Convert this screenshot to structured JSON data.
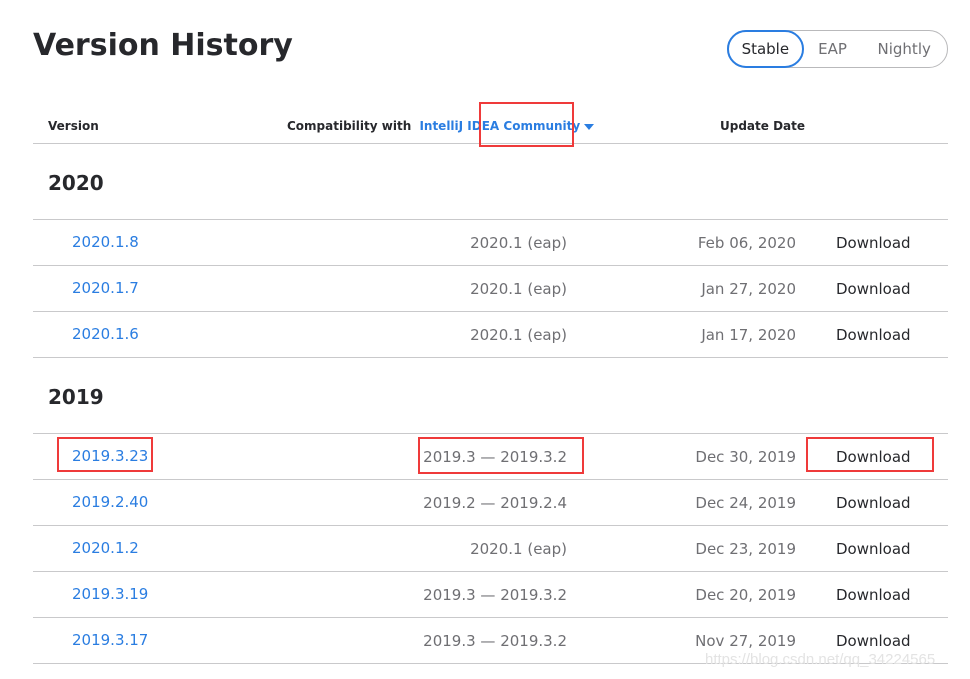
{
  "page": {
    "title": "Version History"
  },
  "channels": [
    {
      "label": "Stable",
      "active": true
    },
    {
      "label": "EAP",
      "active": false
    },
    {
      "label": "Nightly",
      "active": false
    }
  ],
  "table": {
    "headers": {
      "version": "Version",
      "compat_prefix": "Compatibility with",
      "product": "IntelliJ IDEA",
      "edition": "Community",
      "update_date": "Update Date"
    },
    "groups": [
      {
        "year": "2020",
        "rows": [
          {
            "version": "2020.1.8",
            "compat": "2020.1 (eap)",
            "date": "Feb 06, 2020",
            "action": "Download"
          },
          {
            "version": "2020.1.7",
            "compat": "2020.1 (eap)",
            "date": "Jan 27, 2020",
            "action": "Download"
          },
          {
            "version": "2020.1.6",
            "compat": "2020.1 (eap)",
            "date": "Jan 17, 2020",
            "action": "Download"
          }
        ]
      },
      {
        "year": "2019",
        "rows": [
          {
            "version": "2019.3.23",
            "compat": "2019.3 — 2019.3.2",
            "date": "Dec 30, 2019",
            "action": "Download"
          },
          {
            "version": "2019.2.40",
            "compat": "2019.2 — 2019.2.4",
            "date": "Dec 24, 2019",
            "action": "Download"
          },
          {
            "version": "2020.1.2",
            "compat": "2020.1 (eap)",
            "date": "Dec 23, 2019",
            "action": "Download"
          },
          {
            "version": "2019.3.19",
            "compat": "2019.3 — 2019.3.2",
            "date": "Dec 20, 2019",
            "action": "Download"
          },
          {
            "version": "2019.3.17",
            "compat": "2019.3 — 2019.3.2",
            "date": "Nov 27, 2019",
            "action": "Download"
          }
        ]
      }
    ]
  },
  "colors": {
    "accent": "#2a7de1",
    "annotation": "#ef3a3a",
    "text": "#27282c",
    "muted": "#6f6f73"
  },
  "watermark": "https://blog.csdn.net/qq_34224565"
}
